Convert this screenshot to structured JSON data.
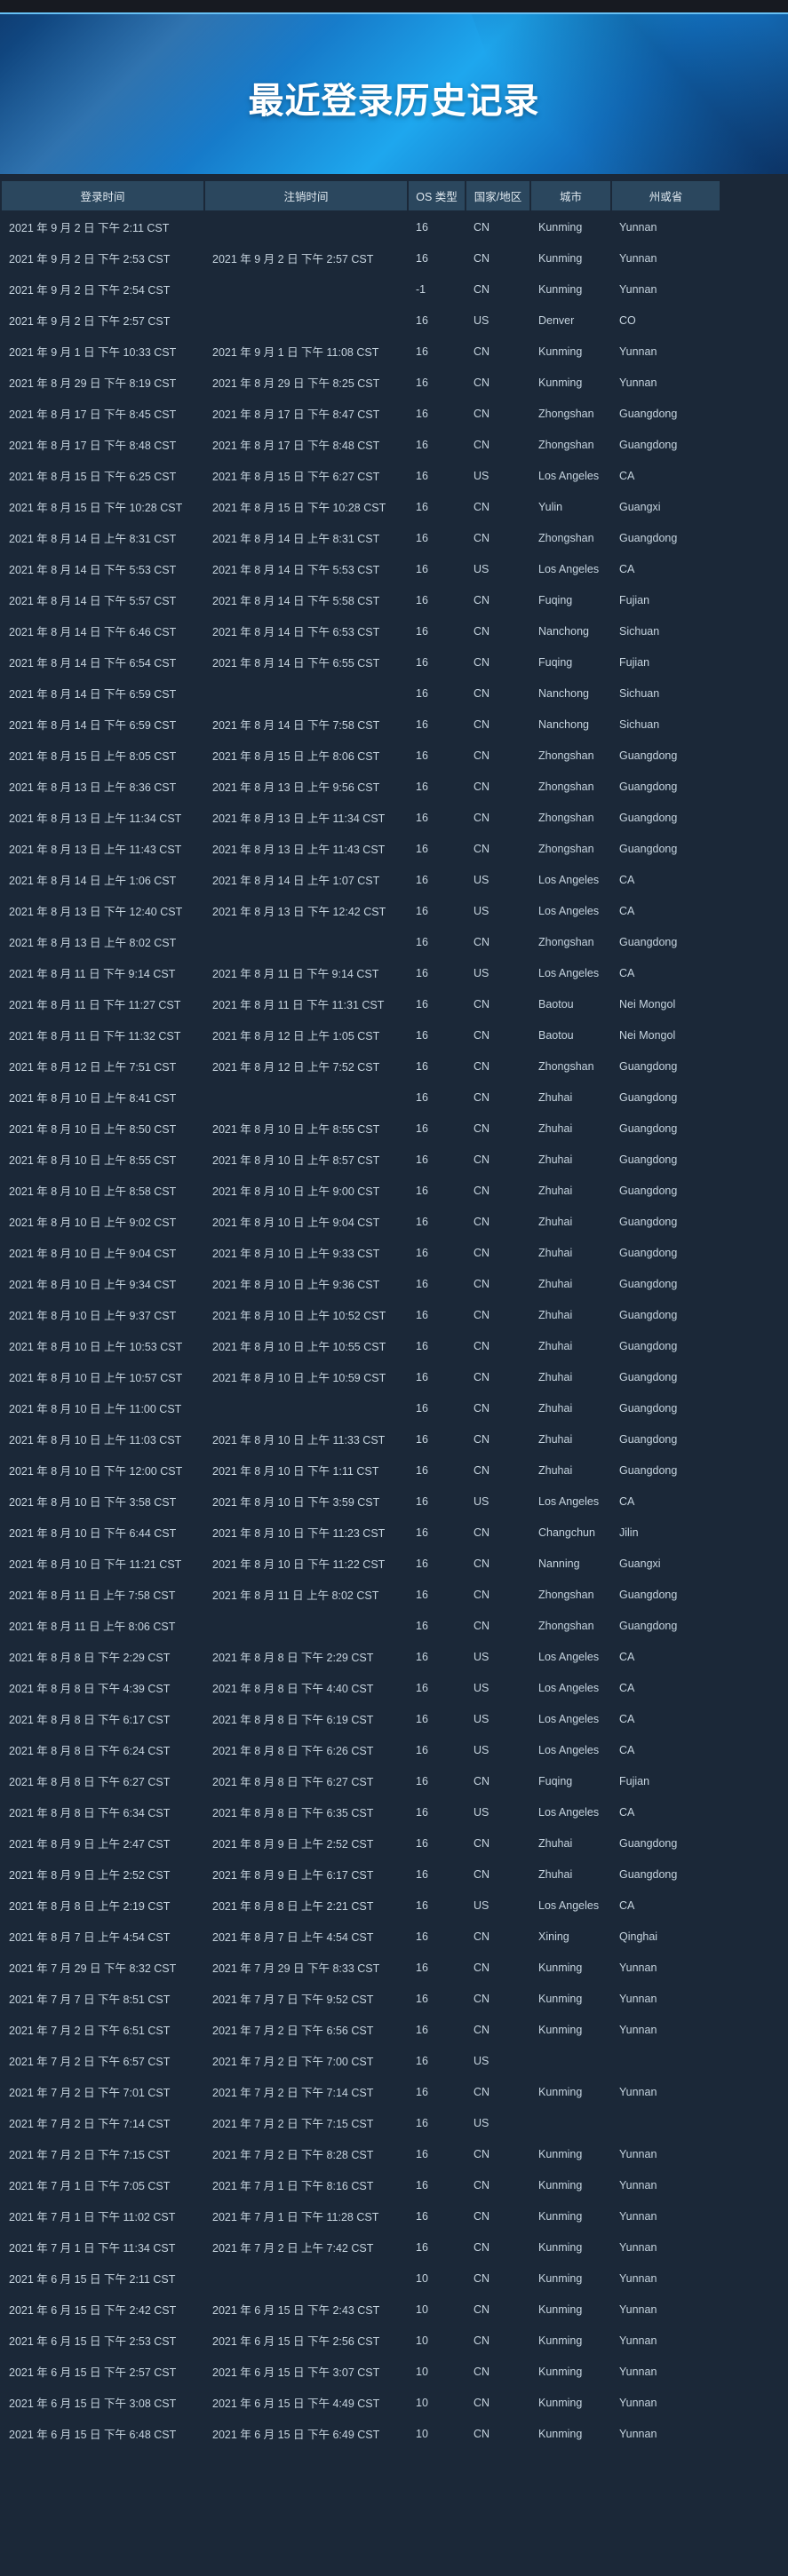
{
  "page": {
    "title": "最近登录历史记录"
  },
  "table": {
    "headers": {
      "login": "登录时间",
      "logout": "注销时间",
      "os": "OS 类型",
      "country": "国家/地区",
      "city": "城市",
      "region": "州或省"
    },
    "rows": [
      [
        "2021 年 9 月 2 日 下午 2:11 CST",
        "",
        "16",
        "CN",
        "Kunming",
        "Yunnan"
      ],
      [
        "2021 年 9 月 2 日 下午 2:53 CST",
        "2021 年 9 月 2 日 下午 2:57 CST",
        "16",
        "CN",
        "Kunming",
        "Yunnan"
      ],
      [
        "2021 年 9 月 2 日 下午 2:54 CST",
        "",
        "-1",
        "CN",
        "Kunming",
        "Yunnan"
      ],
      [
        "2021 年 9 月 2 日 下午 2:57 CST",
        "",
        "16",
        "US",
        "Denver",
        "CO"
      ],
      [
        "2021 年 9 月 1 日 下午 10:33 CST",
        "2021 年 9 月 1 日 下午 11:08 CST",
        "16",
        "CN",
        "Kunming",
        "Yunnan"
      ],
      [
        "2021 年 8 月 29 日 下午 8:19 CST",
        "2021 年 8 月 29 日 下午 8:25 CST",
        "16",
        "CN",
        "Kunming",
        "Yunnan"
      ],
      [
        "2021 年 8 月 17 日 下午 8:45 CST",
        "2021 年 8 月 17 日 下午 8:47 CST",
        "16",
        "CN",
        "Zhongshan",
        "Guangdong"
      ],
      [
        "2021 年 8 月 17 日 下午 8:48 CST",
        "2021 年 8 月 17 日 下午 8:48 CST",
        "16",
        "CN",
        "Zhongshan",
        "Guangdong"
      ],
      [
        "2021 年 8 月 15 日 下午 6:25 CST",
        "2021 年 8 月 15 日 下午 6:27 CST",
        "16",
        "US",
        "Los Angeles",
        "CA"
      ],
      [
        "2021 年 8 月 15 日 下午 10:28 CST",
        "2021 年 8 月 15 日 下午 10:28 CST",
        "16",
        "CN",
        "Yulin",
        "Guangxi"
      ],
      [
        "2021 年 8 月 14 日 上午 8:31 CST",
        "2021 年 8 月 14 日 上午 8:31 CST",
        "16",
        "CN",
        "Zhongshan",
        "Guangdong"
      ],
      [
        "2021 年 8 月 14 日 下午 5:53 CST",
        "2021 年 8 月 14 日 下午 5:53 CST",
        "16",
        "US",
        "Los Angeles",
        "CA"
      ],
      [
        "2021 年 8 月 14 日 下午 5:57 CST",
        "2021 年 8 月 14 日 下午 5:58 CST",
        "16",
        "CN",
        "Fuqing",
        "Fujian"
      ],
      [
        "2021 年 8 月 14 日 下午 6:46 CST",
        "2021 年 8 月 14 日 下午 6:53 CST",
        "16",
        "CN",
        "Nanchong",
        "Sichuan"
      ],
      [
        "2021 年 8 月 14 日 下午 6:54 CST",
        "2021 年 8 月 14 日 下午 6:55 CST",
        "16",
        "CN",
        "Fuqing",
        "Fujian"
      ],
      [
        "2021 年 8 月 14 日 下午 6:59 CST",
        "",
        "16",
        "CN",
        "Nanchong",
        "Sichuan"
      ],
      [
        "2021 年 8 月 14 日 下午 6:59 CST",
        "2021 年 8 月 14 日 下午 7:58 CST",
        "16",
        "CN",
        "Nanchong",
        "Sichuan"
      ],
      [
        "2021 年 8 月 15 日 上午 8:05 CST",
        "2021 年 8 月 15 日 上午 8:06 CST",
        "16",
        "CN",
        "Zhongshan",
        "Guangdong"
      ],
      [
        "2021 年 8 月 13 日 上午 8:36 CST",
        "2021 年 8 月 13 日 上午 9:56 CST",
        "16",
        "CN",
        "Zhongshan",
        "Guangdong"
      ],
      [
        "2021 年 8 月 13 日 上午 11:34 CST",
        "2021 年 8 月 13 日 上午 11:34 CST",
        "16",
        "CN",
        "Zhongshan",
        "Guangdong"
      ],
      [
        "2021 年 8 月 13 日 上午 11:43 CST",
        "2021 年 8 月 13 日 上午 11:43 CST",
        "16",
        "CN",
        "Zhongshan",
        "Guangdong"
      ],
      [
        "2021 年 8 月 14 日 上午 1:06 CST",
        "2021 年 8 月 14 日 上午 1:07 CST",
        "16",
        "US",
        "Los Angeles",
        "CA"
      ],
      [
        "2021 年 8 月 13 日 下午 12:40 CST",
        "2021 年 8 月 13 日 下午 12:42 CST",
        "16",
        "US",
        "Los Angeles",
        "CA"
      ],
      [
        "2021 年 8 月 13 日 上午 8:02 CST",
        "",
        "16",
        "CN",
        "Zhongshan",
        "Guangdong"
      ],
      [
        "2021 年 8 月 11 日 下午 9:14 CST",
        "2021 年 8 月 11 日 下午 9:14 CST",
        "16",
        "US",
        "Los Angeles",
        "CA"
      ],
      [
        "2021 年 8 月 11 日 下午 11:27 CST",
        "2021 年 8 月 11 日 下午 11:31 CST",
        "16",
        "CN",
        "Baotou",
        "Nei Mongol"
      ],
      [
        "2021 年 8 月 11 日 下午 11:32 CST",
        "2021 年 8 月 12 日 上午 1:05 CST",
        "16",
        "CN",
        "Baotou",
        "Nei Mongol"
      ],
      [
        "2021 年 8 月 12 日 上午 7:51 CST",
        "2021 年 8 月 12 日 上午 7:52 CST",
        "16",
        "CN",
        "Zhongshan",
        "Guangdong"
      ],
      [
        "2021 年 8 月 10 日 上午 8:41 CST",
        "",
        "16",
        "CN",
        "Zhuhai",
        "Guangdong"
      ],
      [
        "2021 年 8 月 10 日 上午 8:50 CST",
        "2021 年 8 月 10 日 上午 8:55 CST",
        "16",
        "CN",
        "Zhuhai",
        "Guangdong"
      ],
      [
        "2021 年 8 月 10 日 上午 8:55 CST",
        "2021 年 8 月 10 日 上午 8:57 CST",
        "16",
        "CN",
        "Zhuhai",
        "Guangdong"
      ],
      [
        "2021 年 8 月 10 日 上午 8:58 CST",
        "2021 年 8 月 10 日 上午 9:00 CST",
        "16",
        "CN",
        "Zhuhai",
        "Guangdong"
      ],
      [
        "2021 年 8 月 10 日 上午 9:02 CST",
        "2021 年 8 月 10 日 上午 9:04 CST",
        "16",
        "CN",
        "Zhuhai",
        "Guangdong"
      ],
      [
        "2021 年 8 月 10 日 上午 9:04 CST",
        "2021 年 8 月 10 日 上午 9:33 CST",
        "16",
        "CN",
        "Zhuhai",
        "Guangdong"
      ],
      [
        "2021 年 8 月 10 日 上午 9:34 CST",
        "2021 年 8 月 10 日 上午 9:36 CST",
        "16",
        "CN",
        "Zhuhai",
        "Guangdong"
      ],
      [
        "2021 年 8 月 10 日 上午 9:37 CST",
        "2021 年 8 月 10 日 上午 10:52 CST",
        "16",
        "CN",
        "Zhuhai",
        "Guangdong"
      ],
      [
        "2021 年 8 月 10 日 上午 10:53 CST",
        "2021 年 8 月 10 日 上午 10:55 CST",
        "16",
        "CN",
        "Zhuhai",
        "Guangdong"
      ],
      [
        "2021 年 8 月 10 日 上午 10:57 CST",
        "2021 年 8 月 10 日 上午 10:59 CST",
        "16",
        "CN",
        "Zhuhai",
        "Guangdong"
      ],
      [
        "2021 年 8 月 10 日 上午 11:00 CST",
        "",
        "16",
        "CN",
        "Zhuhai",
        "Guangdong"
      ],
      [
        "2021 年 8 月 10 日 上午 11:03 CST",
        "2021 年 8 月 10 日 上午 11:33 CST",
        "16",
        "CN",
        "Zhuhai",
        "Guangdong"
      ],
      [
        "2021 年 8 月 10 日 下午 12:00 CST",
        "2021 年 8 月 10 日 下午 1:11 CST",
        "16",
        "CN",
        "Zhuhai",
        "Guangdong"
      ],
      [
        "2021 年 8 月 10 日 下午 3:58 CST",
        "2021 年 8 月 10 日 下午 3:59 CST",
        "16",
        "US",
        "Los Angeles",
        "CA"
      ],
      [
        "2021 年 8 月 10 日 下午 6:44 CST",
        "2021 年 8 月 10 日 下午 11:23 CST",
        "16",
        "CN",
        "Changchun",
        "Jilin"
      ],
      [
        "2021 年 8 月 10 日 下午 11:21 CST",
        "2021 年 8 月 10 日 下午 11:22 CST",
        "16",
        "CN",
        "Nanning",
        "Guangxi"
      ],
      [
        "2021 年 8 月 11 日 上午 7:58 CST",
        "2021 年 8 月 11 日 上午 8:02 CST",
        "16",
        "CN",
        "Zhongshan",
        "Guangdong"
      ],
      [
        "2021 年 8 月 11 日 上午 8:06 CST",
        "",
        "16",
        "CN",
        "Zhongshan",
        "Guangdong"
      ],
      [
        "2021 年 8 月 8 日 下午 2:29 CST",
        "2021 年 8 月 8 日 下午 2:29 CST",
        "16",
        "US",
        "Los Angeles",
        "CA"
      ],
      [
        "2021 年 8 月 8 日 下午 4:39 CST",
        "2021 年 8 月 8 日 下午 4:40 CST",
        "16",
        "US",
        "Los Angeles",
        "CA"
      ],
      [
        "2021 年 8 月 8 日 下午 6:17 CST",
        "2021 年 8 月 8 日 下午 6:19 CST",
        "16",
        "US",
        "Los Angeles",
        "CA"
      ],
      [
        "2021 年 8 月 8 日 下午 6:24 CST",
        "2021 年 8 月 8 日 下午 6:26 CST",
        "16",
        "US",
        "Los Angeles",
        "CA"
      ],
      [
        "2021 年 8 月 8 日 下午 6:27 CST",
        "2021 年 8 月 8 日 下午 6:27 CST",
        "16",
        "CN",
        "Fuqing",
        "Fujian"
      ],
      [
        "2021 年 8 月 8 日 下午 6:34 CST",
        "2021 年 8 月 8 日 下午 6:35 CST",
        "16",
        "US",
        "Los Angeles",
        "CA"
      ],
      [
        "2021 年 8 月 9 日 上午 2:47 CST",
        "2021 年 8 月 9 日 上午 2:52 CST",
        "16",
        "CN",
        "Zhuhai",
        "Guangdong"
      ],
      [
        "2021 年 8 月 9 日 上午 2:52 CST",
        "2021 年 8 月 9 日 上午 6:17 CST",
        "16",
        "CN",
        "Zhuhai",
        "Guangdong"
      ],
      [
        "2021 年 8 月 8 日 上午 2:19 CST",
        "2021 年 8 月 8 日 上午 2:21 CST",
        "16",
        "US",
        "Los Angeles",
        "CA"
      ],
      [
        "2021 年 8 月 7 日 上午 4:54 CST",
        "2021 年 8 月 7 日 上午 4:54 CST",
        "16",
        "CN",
        "Xining",
        "Qinghai"
      ],
      [
        "2021 年 7 月 29 日 下午 8:32 CST",
        "2021 年 7 月 29 日 下午 8:33 CST",
        "16",
        "CN",
        "Kunming",
        "Yunnan"
      ],
      [
        "2021 年 7 月 7 日 下午 8:51 CST",
        "2021 年 7 月 7 日 下午 9:52 CST",
        "16",
        "CN",
        "Kunming",
        "Yunnan"
      ],
      [
        "2021 年 7 月 2 日 下午 6:51 CST",
        "2021 年 7 月 2 日 下午 6:56 CST",
        "16",
        "CN",
        "Kunming",
        "Yunnan"
      ],
      [
        "2021 年 7 月 2 日 下午 6:57 CST",
        "2021 年 7 月 2 日 下午 7:00 CST",
        "16",
        "US",
        "",
        ""
      ],
      [
        "2021 年 7 月 2 日 下午 7:01 CST",
        "2021 年 7 月 2 日 下午 7:14 CST",
        "16",
        "CN",
        "Kunming",
        "Yunnan"
      ],
      [
        "2021 年 7 月 2 日 下午 7:14 CST",
        "2021 年 7 月 2 日 下午 7:15 CST",
        "16",
        "US",
        "",
        ""
      ],
      [
        "2021 年 7 月 2 日 下午 7:15 CST",
        "2021 年 7 月 2 日 下午 8:28 CST",
        "16",
        "CN",
        "Kunming",
        "Yunnan"
      ],
      [
        "2021 年 7 月 1 日 下午 7:05 CST",
        "2021 年 7 月 1 日 下午 8:16 CST",
        "16",
        "CN",
        "Kunming",
        "Yunnan"
      ],
      [
        "2021 年 7 月 1 日 下午 11:02 CST",
        "2021 年 7 月 1 日 下午 11:28 CST",
        "16",
        "CN",
        "Kunming",
        "Yunnan"
      ],
      [
        "2021 年 7 月 1 日 下午 11:34 CST",
        "2021 年 7 月 2 日 上午 7:42 CST",
        "16",
        "CN",
        "Kunming",
        "Yunnan"
      ],
      [
        "2021 年 6 月 15 日 下午 2:11 CST",
        "",
        "10",
        "CN",
        "Kunming",
        "Yunnan"
      ],
      [
        "2021 年 6 月 15 日 下午 2:42 CST",
        "2021 年 6 月 15 日 下午 2:43 CST",
        "10",
        "CN",
        "Kunming",
        "Yunnan"
      ],
      [
        "2021 年 6 月 15 日 下午 2:53 CST",
        "2021 年 6 月 15 日 下午 2:56 CST",
        "10",
        "CN",
        "Kunming",
        "Yunnan"
      ],
      [
        "2021 年 6 月 15 日 下午 2:57 CST",
        "2021 年 6 月 15 日 下午 3:07 CST",
        "10",
        "CN",
        "Kunming",
        "Yunnan"
      ],
      [
        "2021 年 6 月 15 日 下午 3:08 CST",
        "2021 年 6 月 15 日 下午 4:49 CST",
        "10",
        "CN",
        "Kunming",
        "Yunnan"
      ],
      [
        "2021 年 6 月 15 日 下午 6:48 CST",
        "2021 年 6 月 15 日 下午 6:49 CST",
        "10",
        "CN",
        "Kunming",
        "Yunnan"
      ]
    ]
  }
}
